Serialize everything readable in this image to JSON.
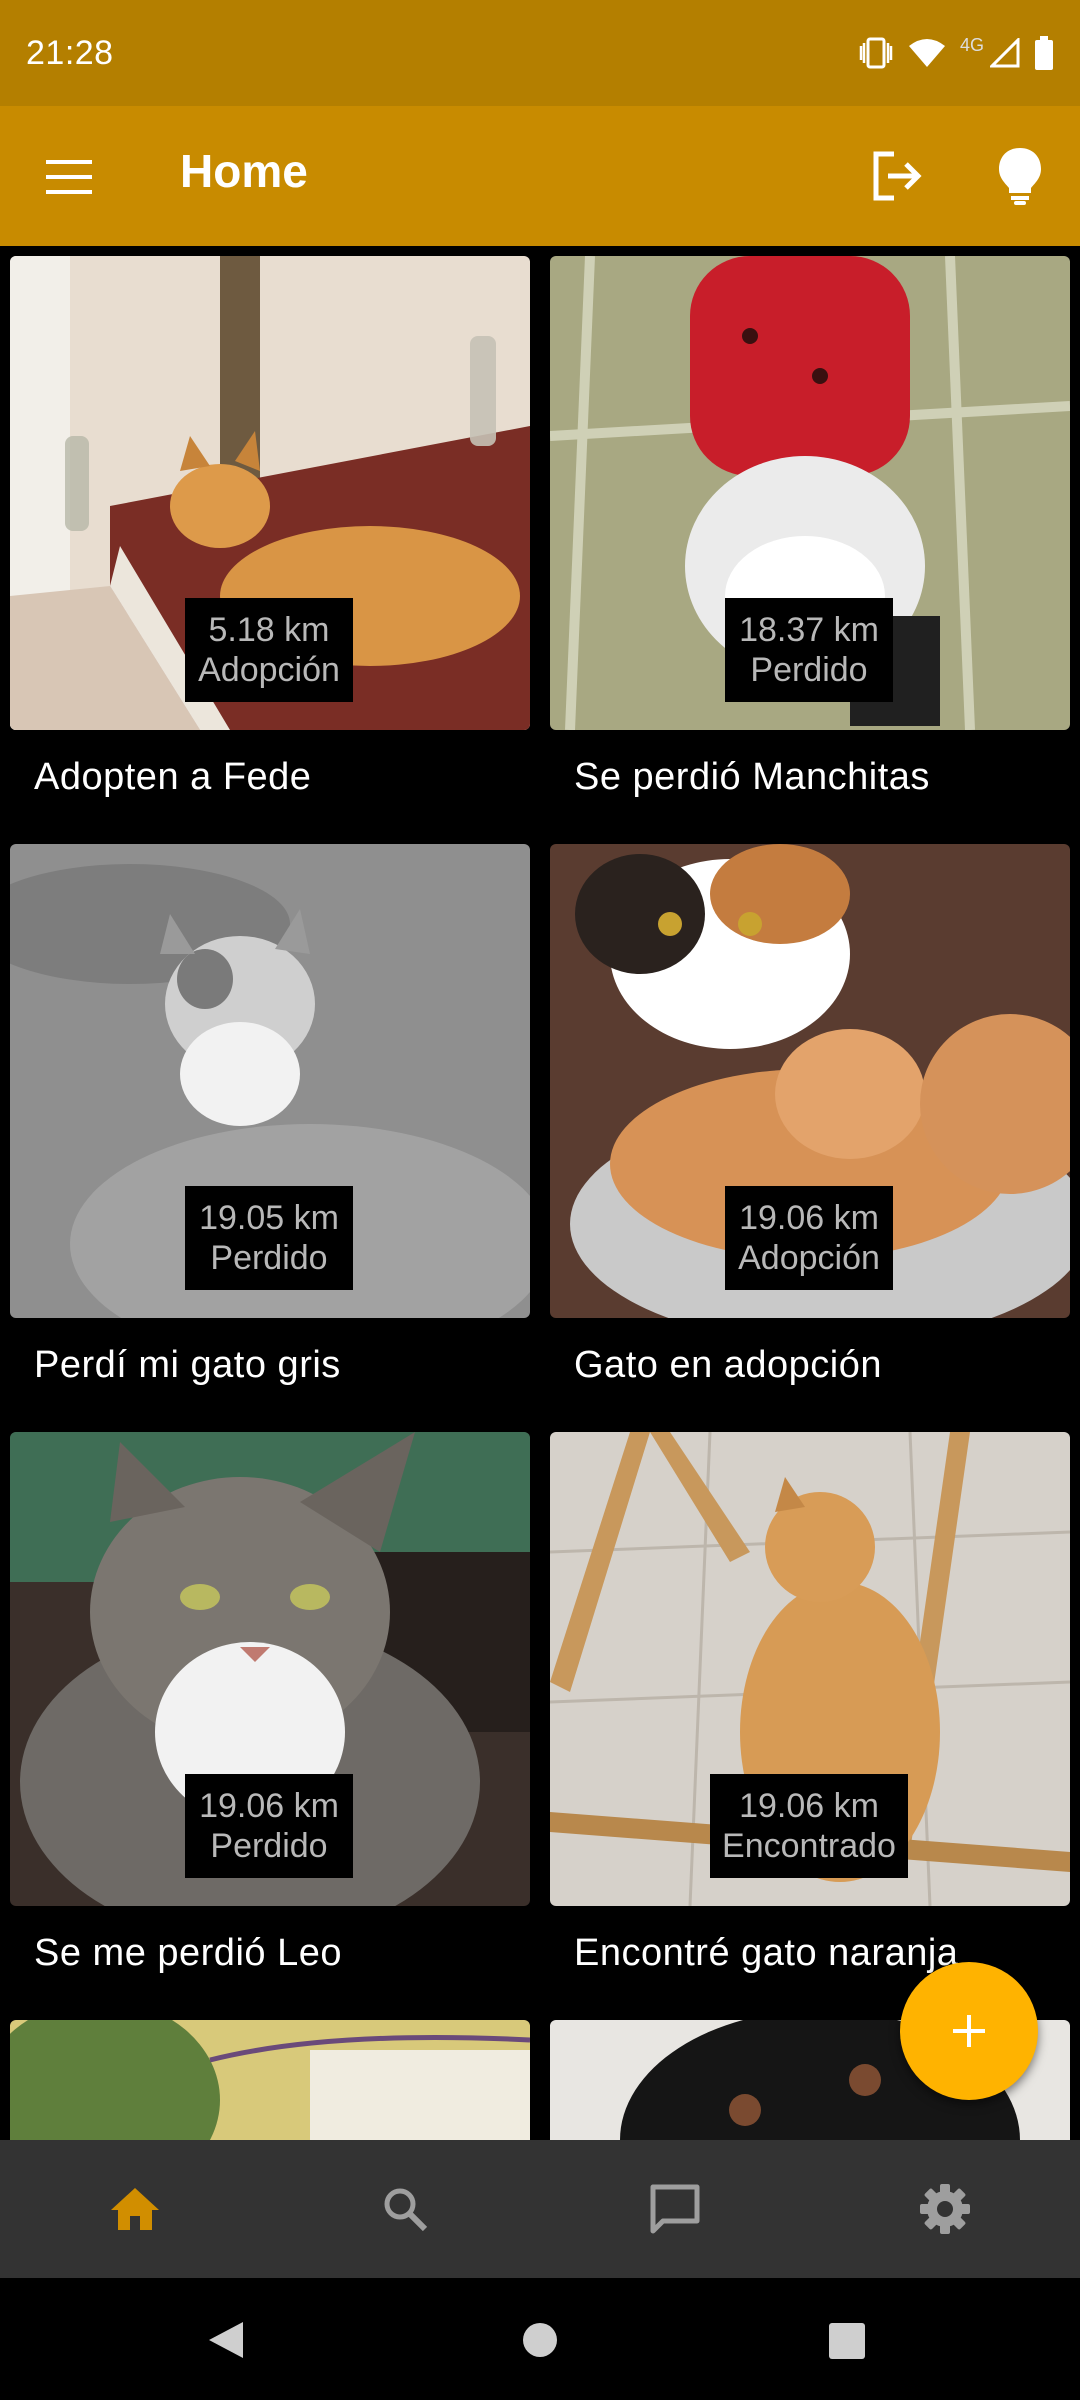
{
  "status_bar": {
    "time": "21:28",
    "network_label": "4G"
  },
  "app_bar": {
    "title": "Home"
  },
  "posts": [
    {
      "distance": "5.18 km",
      "status": "Adopción",
      "title": "Adopten a Fede"
    },
    {
      "distance": "18.37 km",
      "status": "Perdido",
      "title": "Se perdió Manchitas"
    },
    {
      "distance": "19.05 km",
      "status": "Perdido",
      "title": "Perdí mi gato gris"
    },
    {
      "distance": "19.06 km",
      "status": "Adopción",
      "title": "Gato en adopción"
    },
    {
      "distance": "19.06 km",
      "status": "Perdido",
      "title": "Se me perdió Leo"
    },
    {
      "distance": "19.06 km",
      "status": "Encontrado",
      "title": "Encontré gato naranja"
    }
  ],
  "bottom_nav": [
    {
      "icon": "home-icon",
      "active": true
    },
    {
      "icon": "search-icon",
      "active": false
    },
    {
      "icon": "chat-icon",
      "active": false
    },
    {
      "icon": "settings-icon",
      "active": false
    }
  ],
  "colors": {
    "status_bar": "#B47F00",
    "app_bar": "#C88B00",
    "fab": "#FFB300",
    "active_nav": "#D18E00",
    "inactive_nav": "#9E9E9E",
    "bottom_nav_bg": "#333333"
  }
}
